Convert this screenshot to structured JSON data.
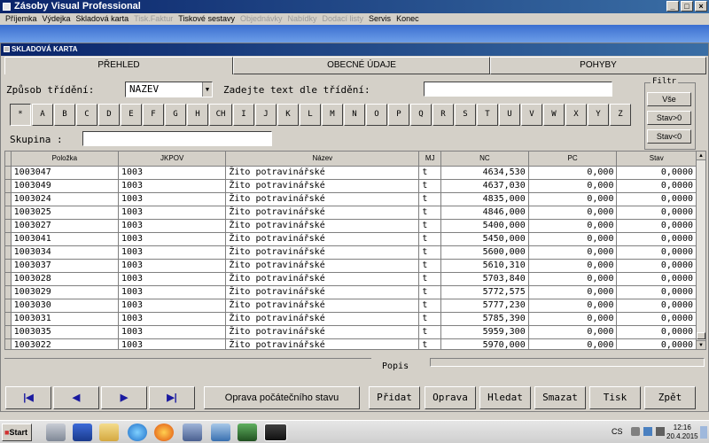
{
  "app": {
    "title": "Zásoby Visual Professional"
  },
  "window_buttons": {
    "minimize": "_",
    "maximize": "□",
    "close": "×"
  },
  "menu": [
    {
      "label": "Příjemka",
      "enabled": true
    },
    {
      "label": "Výdejka",
      "enabled": true
    },
    {
      "label": "Skladová karta",
      "enabled": true
    },
    {
      "label": "Tisk.Faktur",
      "enabled": false
    },
    {
      "label": "Tiskové sestavy",
      "enabled": true
    },
    {
      "label": "Objednávky",
      "enabled": false
    },
    {
      "label": "Nabídky",
      "enabled": false
    },
    {
      "label": "Dodací listy",
      "enabled": false
    },
    {
      "label": "Servis",
      "enabled": true
    },
    {
      "label": "Konec",
      "enabled": true
    }
  ],
  "child": {
    "title": "SKLADOVÁ KARTA"
  },
  "tabs": [
    {
      "label": "PŘEHLED",
      "active": true
    },
    {
      "label": "OBECNÉ ÚDAJE",
      "active": false
    },
    {
      "label": "POHYBY",
      "active": false
    }
  ],
  "sort": {
    "label": "Způsob třídění:",
    "value": "NAZEV",
    "dropdown_icon": "▼"
  },
  "search": {
    "label": "Zadejte text dle třídění:",
    "value": ""
  },
  "letters": [
    "*",
    "A",
    "B",
    "C",
    "D",
    "E",
    "F",
    "G",
    "H",
    "CH",
    "I",
    "J",
    "K",
    "L",
    "M",
    "N",
    "O",
    "P",
    "Q",
    "R",
    "S",
    "T",
    "U",
    "V",
    "W",
    "X",
    "Y",
    "Z"
  ],
  "group": {
    "label": "Skupina :",
    "value": ""
  },
  "filter": {
    "label": "Filtr",
    "buttons": [
      "Vše",
      "Stav>0",
      "Stav<0"
    ]
  },
  "table": {
    "columns": [
      "Položka",
      "JKPOV",
      "Název",
      "MJ",
      "NC",
      "PC",
      "Stav"
    ],
    "rows": [
      [
        "1003047",
        "1003",
        "Žito potravinářské",
        "t",
        "4634,530",
        "0,000",
        "0,0000"
      ],
      [
        "1003049",
        "1003",
        "Žito potravinářské",
        "t",
        "4637,030",
        "0,000",
        "0,0000"
      ],
      [
        "1003024",
        "1003",
        "Žito potravinářské",
        "t",
        "4835,000",
        "0,000",
        "0,0000"
      ],
      [
        "1003025",
        "1003",
        "Žito potravinářské",
        "t",
        "4846,000",
        "0,000",
        "0,0000"
      ],
      [
        "1003027",
        "1003",
        "Žito potravinářské",
        "t",
        "5400,000",
        "0,000",
        "0,0000"
      ],
      [
        "1003041",
        "1003",
        "Žito potravinářské",
        "t",
        "5450,000",
        "0,000",
        "0,0000"
      ],
      [
        "1003034",
        "1003",
        "Žito potravinářské",
        "t",
        "5600,000",
        "0,000",
        "0,0000"
      ],
      [
        "1003037",
        "1003",
        "Žito potravinářské",
        "t",
        "5610,310",
        "0,000",
        "0,0000"
      ],
      [
        "1003028",
        "1003",
        "Žito potravinářské",
        "t",
        "5703,840",
        "0,000",
        "0,0000"
      ],
      [
        "1003029",
        "1003",
        "Žito potravinářské",
        "t",
        "5772,575",
        "0,000",
        "0,0000"
      ],
      [
        "1003030",
        "1003",
        "Žito potravinářské",
        "t",
        "5777,230",
        "0,000",
        "0,0000"
      ],
      [
        "1003031",
        "1003",
        "Žito potravinářské",
        "t",
        "5785,390",
        "0,000",
        "0,0000"
      ],
      [
        "1003035",
        "1003",
        "Žito potravinářské",
        "t",
        "5959,300",
        "0,000",
        "0,0000"
      ],
      [
        "1003022",
        "1003",
        "Žito potravinářské",
        "t",
        "5970,000",
        "0,000",
        "0,0000"
      ]
    ]
  },
  "popis": {
    "label": "Popis"
  },
  "nav": {
    "first": "|◀",
    "prev": "◀",
    "next": "▶",
    "last": "▶|"
  },
  "buttons": {
    "correction": "Oprava počátečního stavu",
    "add": "Přidat",
    "edit": "Oprava",
    "find": "Hledat",
    "delete": "Smazat",
    "print": "Tisk",
    "back": "Zpět"
  },
  "taskbar": {
    "start": "Start",
    "lang": "CS",
    "time": "12:16",
    "date": "20.4.2015",
    "icon_names": [
      "server-icon",
      "powershell-icon",
      "folder-icon",
      "ie-icon",
      "firefox-icon",
      "tools-icon",
      "network-icon",
      "terminal-icon",
      "app-icon"
    ]
  },
  "colors": {
    "title_active": "#0a246a",
    "band": "#3b6fd0",
    "face": "#d4d0c8"
  }
}
